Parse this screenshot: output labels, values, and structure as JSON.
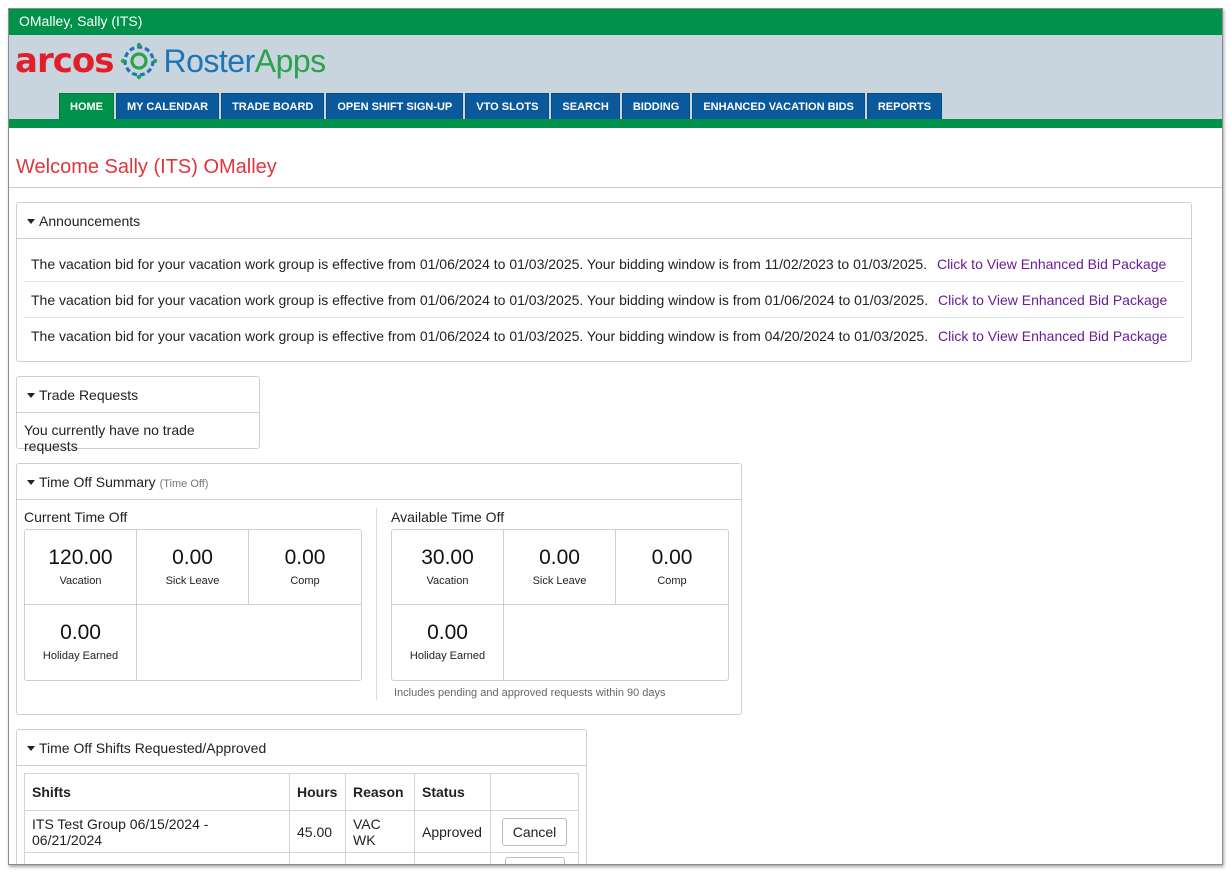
{
  "user_bar": {
    "name": "OMalley, Sally (ITS)"
  },
  "brand": {
    "arcos": "arcos",
    "roster_part1": "Roster",
    "roster_part2": "Apps"
  },
  "nav": {
    "tabs": [
      {
        "label": "HOME",
        "active": true
      },
      {
        "label": "MY CALENDAR"
      },
      {
        "label": "TRADE BOARD"
      },
      {
        "label": "OPEN SHIFT SIGN-UP"
      },
      {
        "label": "VTO SLOTS"
      },
      {
        "label": "SEARCH"
      },
      {
        "label": "BIDDING"
      },
      {
        "label": "ENHANCED VACATION BIDS"
      },
      {
        "label": "REPORTS"
      }
    ]
  },
  "welcome": "Welcome Sally (ITS) OMalley",
  "announcements": {
    "title": "Announcements",
    "items": [
      {
        "text": "The vacation bid for your vacation work group is effective from 01/06/2024 to 01/03/2025. Your bidding window is from 11/02/2023 to 01/03/2025.",
        "link": "Click to View Enhanced Bid Package"
      },
      {
        "text": "The vacation bid for your vacation work group is effective from 01/06/2024 to 01/03/2025. Your bidding window is from 01/06/2024 to 01/03/2025.",
        "link": "Click to View Enhanced Bid Package"
      },
      {
        "text": "The vacation bid for your vacation work group is effective from 01/06/2024 to 01/03/2025. Your bidding window is from 04/20/2024 to 01/03/2025.",
        "link": "Click to View Enhanced Bid Package"
      }
    ]
  },
  "trade_requests": {
    "title": "Trade Requests",
    "message": "You currently have no trade requests"
  },
  "time_off_summary": {
    "title": "Time Off Summary",
    "subtitle": "(Time Off)",
    "current": {
      "title": "Current Time Off",
      "cells": [
        {
          "value": "120.00",
          "label": "Vacation"
        },
        {
          "value": "0.00",
          "label": "Sick Leave"
        },
        {
          "value": "0.00",
          "label": "Comp"
        },
        {
          "value": "0.00",
          "label": "Holiday Earned"
        }
      ]
    },
    "available": {
      "title": "Available Time Off",
      "cells": [
        {
          "value": "30.00",
          "label": "Vacation"
        },
        {
          "value": "0.00",
          "label": "Sick Leave"
        },
        {
          "value": "0.00",
          "label": "Comp"
        },
        {
          "value": "0.00",
          "label": "Holiday Earned"
        }
      ],
      "note": "Includes pending and approved requests within 90 days"
    }
  },
  "time_off_shifts": {
    "title": "Time Off Shifts Requested/Approved",
    "columns": [
      "Shifts",
      "Hours",
      "Reason",
      "Status",
      ""
    ],
    "rows": [
      {
        "shift": "ITS Test Group 06/15/2024 - 06/21/2024",
        "hours": "45.00",
        "reason": "VAC WK",
        "status": "Approved",
        "action": "Cancel"
      }
    ]
  },
  "colors": {
    "green": "#00924a",
    "nav_blue": "#0a5a9b",
    "header_bg": "#c8d5de",
    "welcome_red": "#e0353b",
    "link_purple": "#6a1b9a"
  }
}
